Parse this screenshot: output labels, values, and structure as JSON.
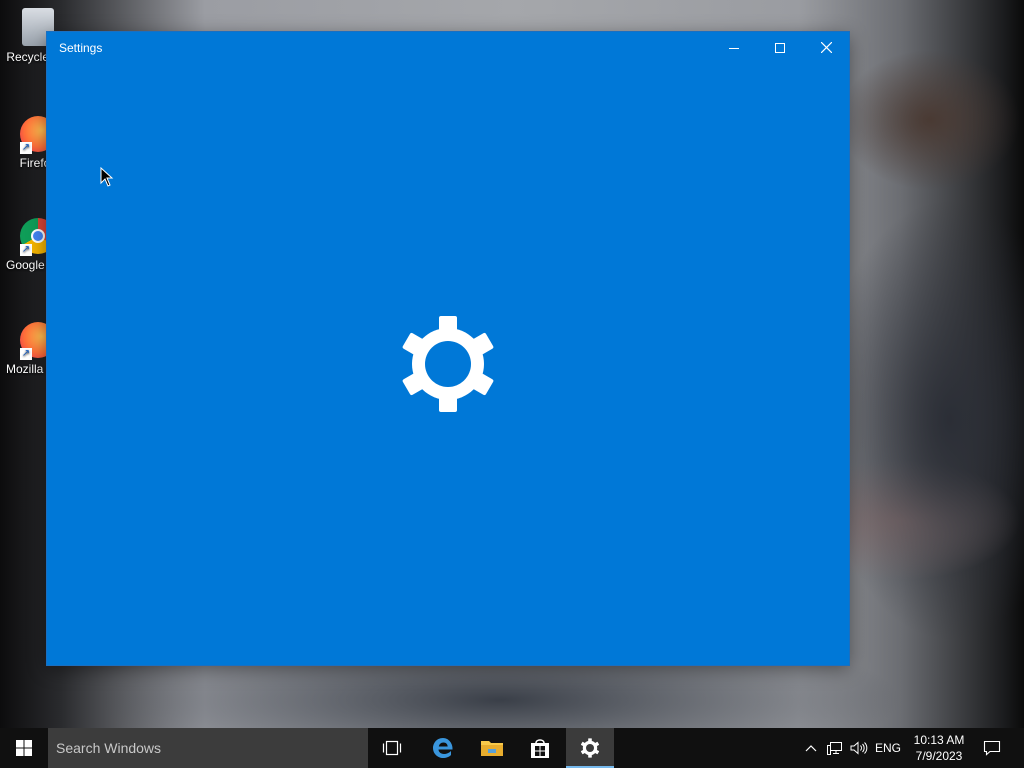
{
  "desktop": {
    "icons": [
      {
        "label": "Recycle Bin"
      },
      {
        "label": "Firefox"
      },
      {
        "label": "Google Chrome"
      },
      {
        "label": "Mozilla Firefox"
      }
    ]
  },
  "window": {
    "title": "Settings",
    "accent_color": "#0078d7",
    "controls": {
      "minimize_icon": "minimize-icon",
      "maximize_icon": "maximize-icon",
      "close_icon": "close-icon"
    },
    "splash_icon": "gear-icon"
  },
  "taskbar": {
    "search_placeholder": "Search Windows",
    "apps": [
      {
        "name": "Task View",
        "icon": "task-view-icon"
      },
      {
        "name": "Microsoft Edge",
        "icon": "edge-icon"
      },
      {
        "name": "File Explorer",
        "icon": "folder-icon"
      },
      {
        "name": "Store",
        "icon": "store-icon"
      },
      {
        "name": "Settings",
        "icon": "gear-icon",
        "active": true
      }
    ],
    "tray": {
      "language": "ENG",
      "time": "10:13 AM",
      "date": "7/9/2023"
    }
  }
}
